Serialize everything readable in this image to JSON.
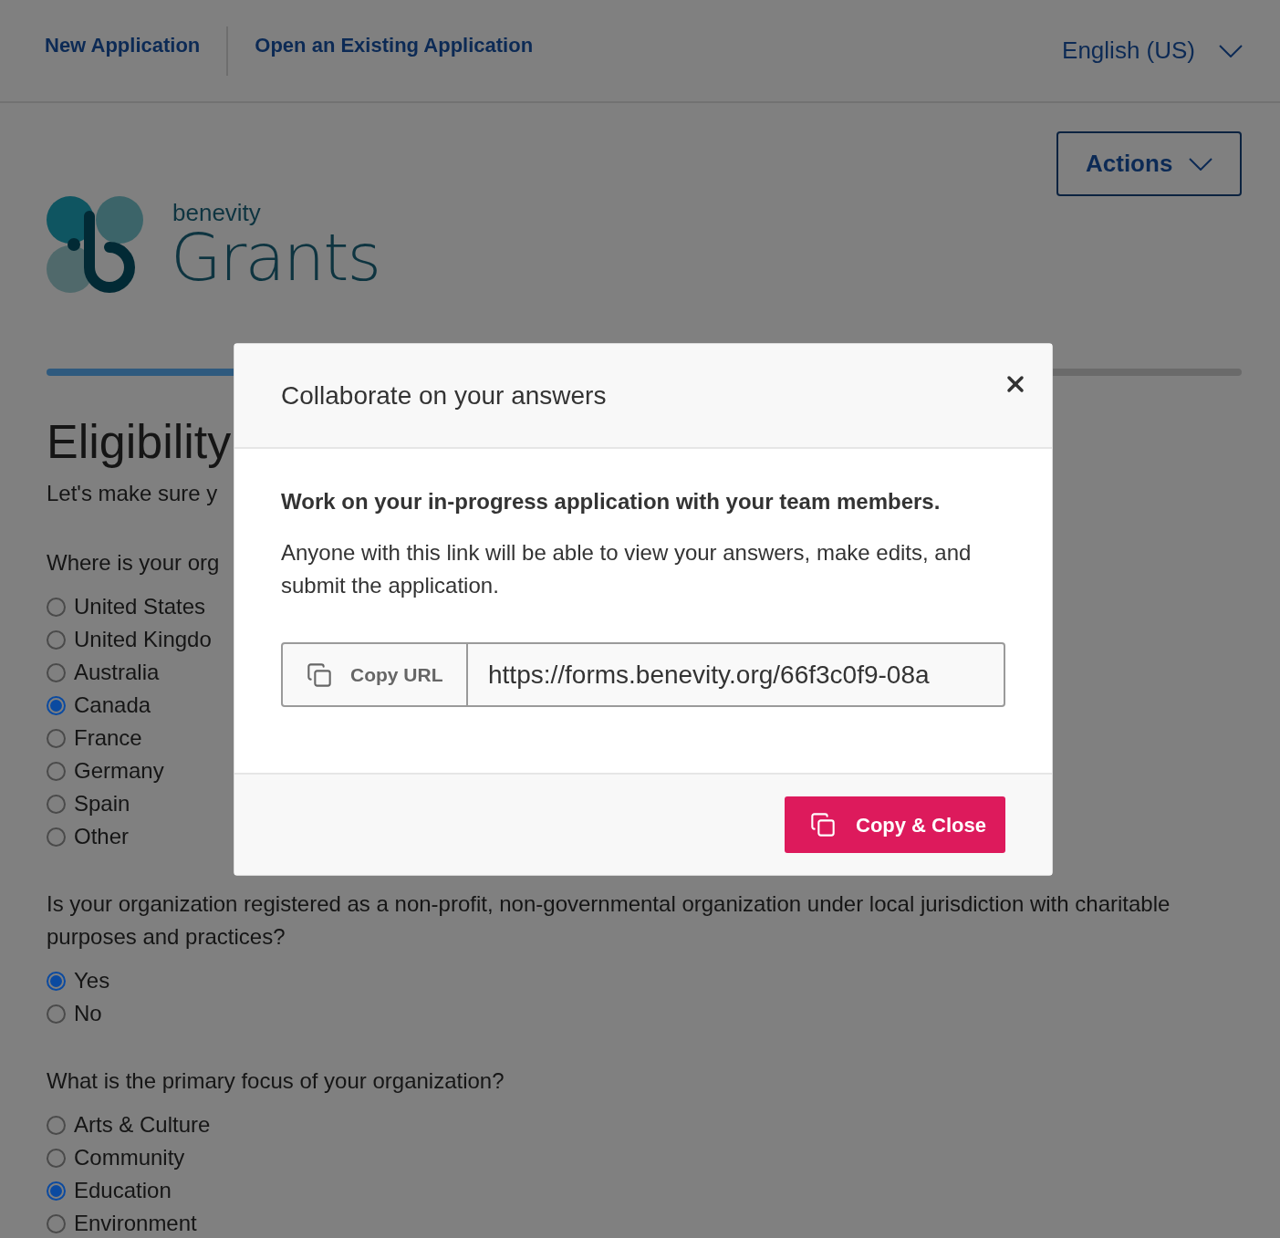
{
  "nav": {
    "links": [
      {
        "label": "New Application"
      },
      {
        "label": "Open an Existing Application"
      }
    ],
    "language": "English (US)"
  },
  "actions_button": {
    "label": "Actions"
  },
  "logo": {
    "brand": "benevity",
    "product": "Grants"
  },
  "page": {
    "title": "Eligibility",
    "subtitle": "Let's make sure y",
    "questions": [
      {
        "prompt": "Where is your org",
        "options": [
          {
            "label": "United States",
            "selected": false
          },
          {
            "label": "United Kingdo",
            "selected": false
          },
          {
            "label": "Australia",
            "selected": false
          },
          {
            "label": "Canada",
            "selected": true
          },
          {
            "label": "France",
            "selected": false
          },
          {
            "label": "Germany",
            "selected": false
          },
          {
            "label": "Spain",
            "selected": false
          },
          {
            "label": "Other",
            "selected": false
          }
        ]
      },
      {
        "prompt": "Is your organization registered as a non-profit, non-governmental organization under local jurisdiction with charitable purposes and practices?",
        "options": [
          {
            "label": "Yes",
            "selected": true
          },
          {
            "label": "No",
            "selected": false
          }
        ]
      },
      {
        "prompt": "What is the primary focus of your organization?",
        "options": [
          {
            "label": "Arts & Culture",
            "selected": false
          },
          {
            "label": "Community",
            "selected": false
          },
          {
            "label": "Education",
            "selected": true
          },
          {
            "label": "Environment",
            "selected": false
          }
        ]
      }
    ]
  },
  "modal": {
    "title": "Collaborate on your answers",
    "lead": "Work on your in-progress application with your team members.",
    "body": "Anyone with this link will be able to view your answers, make edits, and submit the application.",
    "copy_url_button": "Copy URL",
    "url": "https://forms.benevity.org/66f3c0f9-08a",
    "primary_button": "Copy & Close"
  }
}
